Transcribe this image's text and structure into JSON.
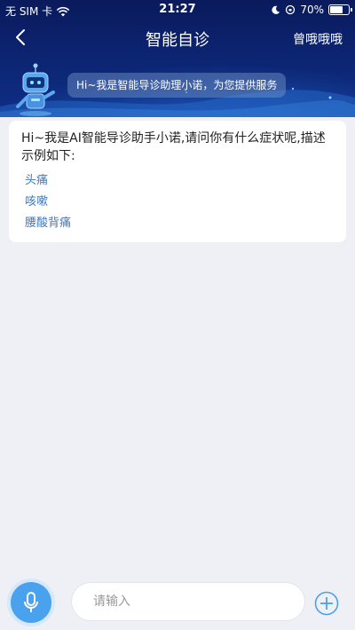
{
  "status_bar": {
    "carrier": "无 SIM 卡",
    "time": "21:27",
    "battery_text": "70%",
    "battery_level": 0.7
  },
  "nav": {
    "title": "智能自诊",
    "right_label": "曾哦哦哦"
  },
  "banner": {
    "greeting": "Hi~我是智能导诊助理小诺，为您提供服务"
  },
  "message": {
    "intro": "Hi~我是AI智能导诊助手小诺,请问你有什么症状呢,描述示例如下:",
    "examples": [
      "头痛",
      "咳嗽",
      "腰酸背痛"
    ]
  },
  "input_bar": {
    "placeholder": "请输入"
  },
  "colors": {
    "header_dark": "#0a1a5c",
    "link_blue": "#3a78c9",
    "mic_blue": "#4aa1ee",
    "page_bg": "#eff0f5"
  }
}
